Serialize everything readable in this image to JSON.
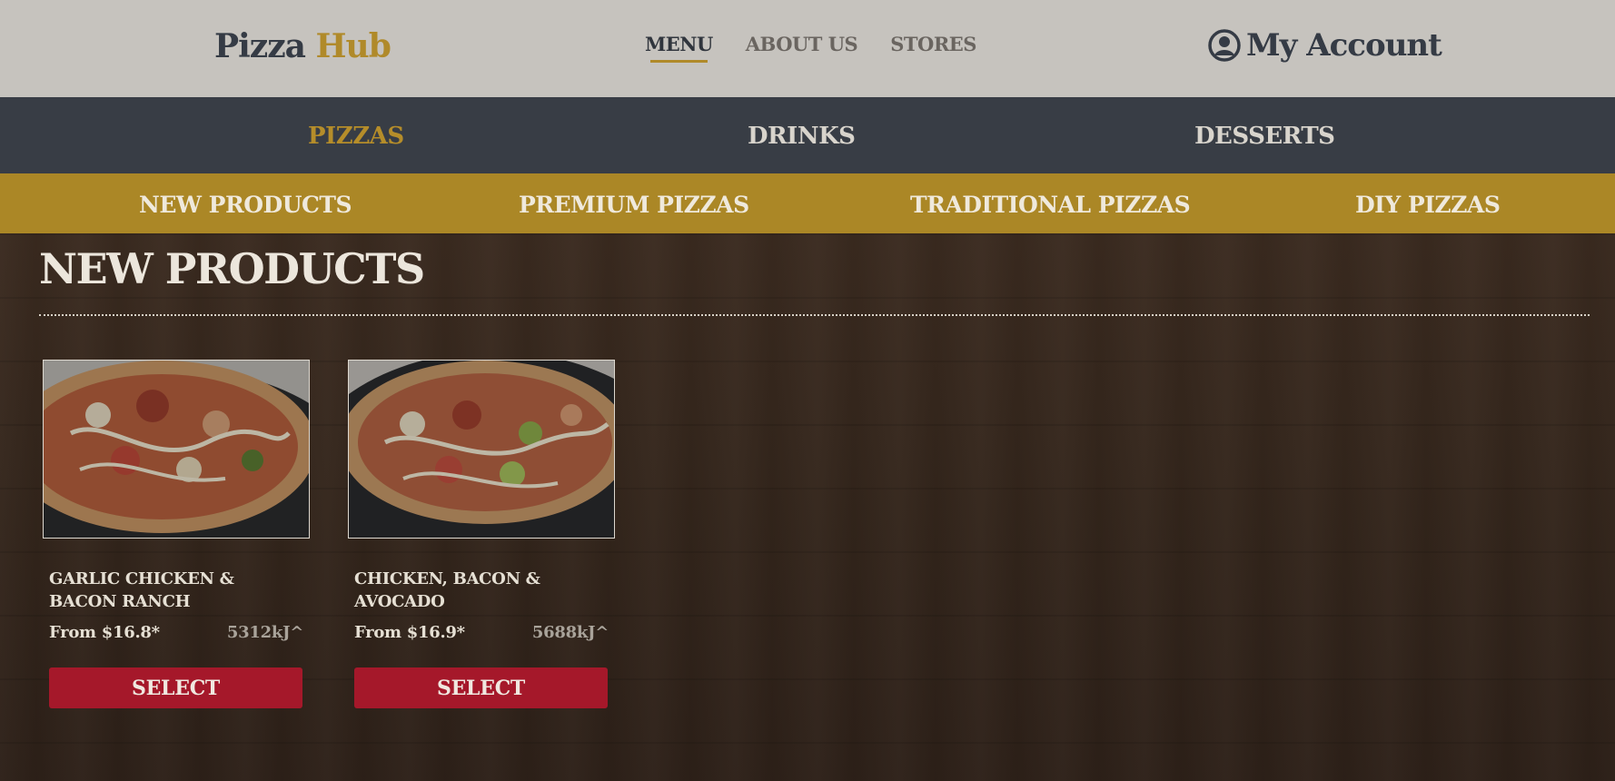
{
  "header": {
    "logo_part1": "Pizza",
    "logo_part2": "Hub",
    "nav": [
      "MENU",
      "ABOUT US",
      "STORES"
    ],
    "account_label": "My Account",
    "account_icon": "user-circle-icon"
  },
  "categories": [
    "PIZZAS",
    "DRINKS",
    "DESSERTS"
  ],
  "subcategories": [
    "NEW PRODUCTS",
    "PREMIUM PIZZAS",
    "TRADITIONAL PIZZAS",
    "DIY PIZZAS"
  ],
  "main": {
    "section_title": "NEW PRODUCTS",
    "products": [
      {
        "name": "GARLIC CHICKEN & BACON RANCH",
        "price": "From $16.8*",
        "energy": "5312kJ^",
        "button": "SELECT"
      },
      {
        "name": "CHICKEN, BACON & AVOCADO",
        "price": "From $16.9*",
        "energy": "5688kJ^",
        "button": "SELECT"
      }
    ]
  },
  "colors": {
    "brand_gold": "#b08a2a",
    "dark_nav": "#383d45",
    "select_red": "#a5182a",
    "header_bg": "#c6c3be"
  }
}
